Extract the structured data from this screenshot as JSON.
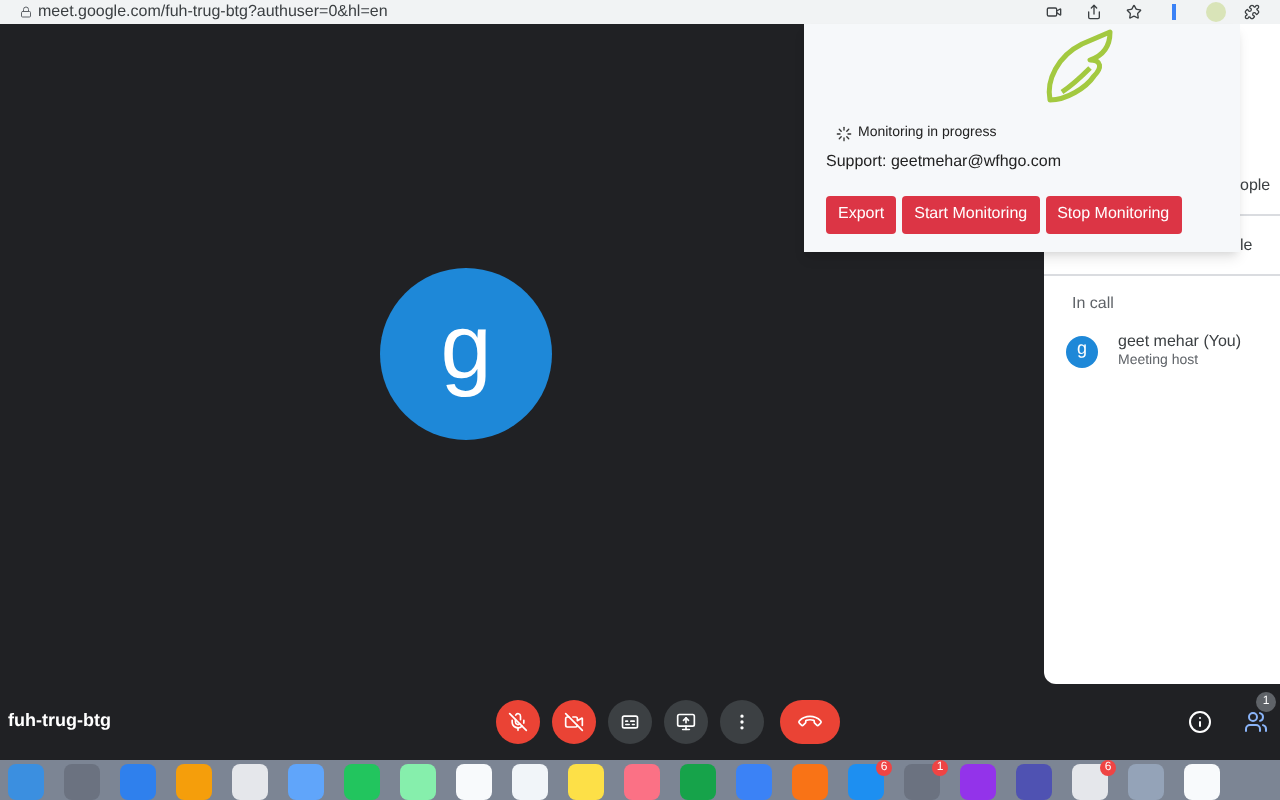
{
  "address_bar": {
    "url": "meet.google.com/fuh-trug-btg?authuser=0&hl=en"
  },
  "stage": {
    "avatar_letter": "g"
  },
  "extension_popup": {
    "status": "Monitoring in progress",
    "support": "Support: geetmehar@wfhgo.com",
    "buttons": [
      "Export",
      "Start Monitoring",
      "Stop Monitoring"
    ]
  },
  "side_panel": {
    "rows": [
      "ople",
      "le"
    ],
    "section": "In call",
    "participants": [
      {
        "initial": "g",
        "name": "geet mehar (You)",
        "role": "Meeting host"
      }
    ]
  },
  "bottom_bar": {
    "meeting_code": "fuh-trug-btg",
    "mic_on": false,
    "camera_on": false,
    "participants_badge": "1"
  },
  "dock": [
    {
      "kind": "finder"
    },
    {
      "kind": "launchpad"
    },
    {
      "kind": "safari"
    },
    {
      "kind": "photos"
    },
    {
      "kind": "chrome"
    },
    {
      "kind": "preview"
    },
    {
      "kind": "facetime"
    },
    {
      "kind": "maps"
    },
    {
      "kind": "calendar"
    },
    {
      "kind": "reminders"
    },
    {
      "kind": "notes"
    },
    {
      "kind": "music"
    },
    {
      "kind": "numbers"
    },
    {
      "kind": "keynote"
    },
    {
      "kind": "pages"
    },
    {
      "kind": "appstore",
      "badge": "6"
    },
    {
      "kind": "settings",
      "badge": "1"
    },
    {
      "kind": "podcasts"
    },
    {
      "kind": "teams"
    },
    {
      "kind": "installer",
      "badge": "6"
    },
    {
      "kind": "imageviewer"
    },
    {
      "kind": "document"
    }
  ]
}
